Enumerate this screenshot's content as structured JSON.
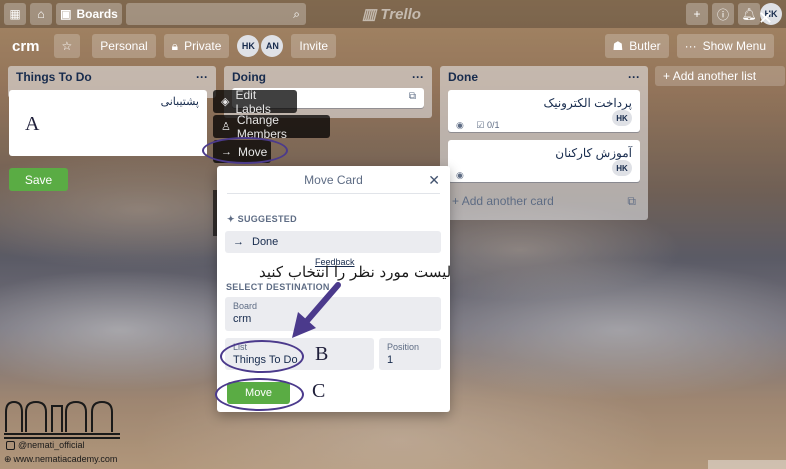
{
  "topbar": {
    "boards_label": "Boards",
    "logo": "Trello",
    "user_initials": "HK"
  },
  "board": {
    "title": "crm",
    "visibility_team": "Personal",
    "visibility": "Private",
    "members": [
      "HK",
      "AN"
    ],
    "invite_label": "Invite",
    "butler_label": "Butler",
    "menu_label": "Show Menu"
  },
  "lists": {
    "todo": {
      "title": "Things To Do",
      "editing_card": "پشتیبانی",
      "save_label": "Save"
    },
    "doing": {
      "title": "Doing"
    },
    "done": {
      "title": "Done",
      "cards": [
        {
          "title": "پرداخت الکترونیک",
          "checklist": "0/1",
          "member": "HK"
        },
        {
          "title": "آموزش کارکنان",
          "member": "HK"
        }
      ],
      "add_card_label": "Add another card"
    },
    "add_list_label": "Add another list"
  },
  "quick_menu": {
    "edit_labels": "Edit Labels",
    "change_members": "Change Members",
    "move": "Move"
  },
  "modal": {
    "title": "Move Card",
    "suggested_heading": "SUGGESTED",
    "suggested_item": "Done",
    "feedback": "Feedback",
    "destination_heading": "SELECT DESTINATION",
    "board_label": "Board",
    "board_value": "crm",
    "list_label": "List",
    "list_value": "Things To Do",
    "position_label": "Position",
    "position_value": "1",
    "move_button": "Move"
  },
  "annotations": {
    "a": "A",
    "b": "B",
    "c": "C",
    "instruction": "لیست مورد نظر را انتخاب کنید",
    "arrow_color": "#4b3a8c"
  },
  "watermark": {
    "instagram": "@nemati_official",
    "site": "www.nematiacademy.com"
  }
}
